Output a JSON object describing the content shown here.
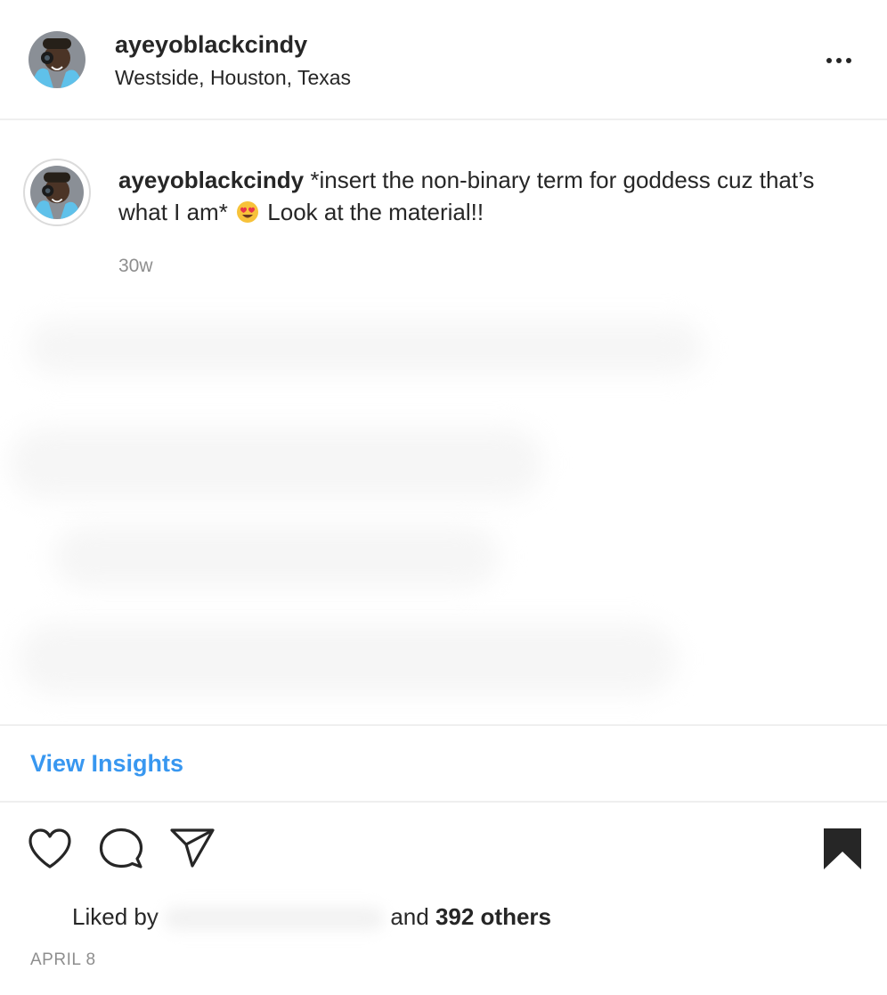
{
  "header": {
    "username": "ayeyoblackcindy",
    "location": "Westside, Houston, Texas",
    "more_icon": "more-horizontal-icon"
  },
  "caption": {
    "username": "ayeyoblackcindy",
    "text_before_emoji": "*insert the non-binary term for goddess cuz that’s what I am*",
    "emoji": "heart-eyes-emoji",
    "text_after_emoji": "Look at the material!!",
    "timestamp": "30w"
  },
  "insights": {
    "label": "View Insights"
  },
  "actions": {
    "like_icon": "heart-icon",
    "comment_icon": "comment-bubble-icon",
    "share_icon": "paper-plane-icon",
    "save_icon": "bookmark-filled-icon"
  },
  "likes": {
    "prefix": "Liked by",
    "conjunction": "and",
    "others": "392 others"
  },
  "post_date": "APRIL 8",
  "colors": {
    "link_blue": "#3897f0",
    "text": "#262626",
    "secondary": "#8e8e8e",
    "divider": "#efefef"
  }
}
